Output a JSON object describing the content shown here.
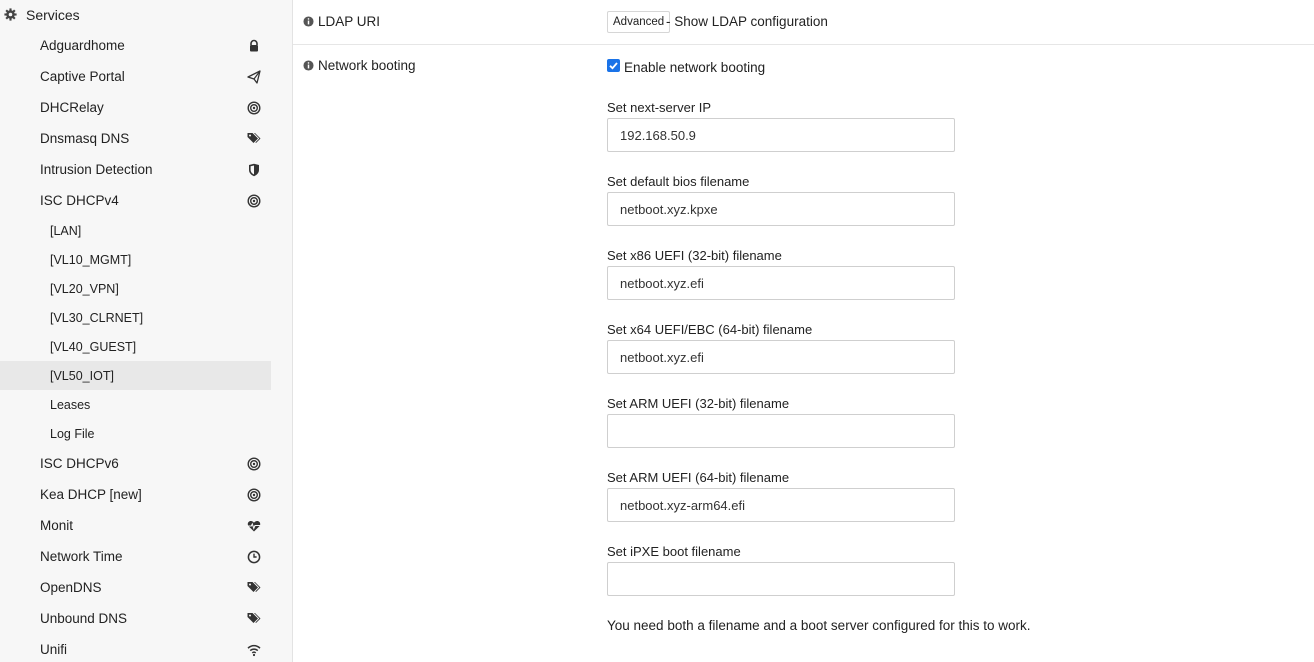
{
  "sidebar": {
    "section": {
      "label": "Services",
      "icon": "gear-icon"
    },
    "items": [
      {
        "label": "Adguardhome",
        "icon": "lock-icon"
      },
      {
        "label": "Captive Portal",
        "icon": "paper-plane-icon"
      },
      {
        "label": "DHCRelay",
        "icon": "bullseye-icon"
      },
      {
        "label": "Dnsmasq DNS",
        "icon": "tags-icon"
      },
      {
        "label": "Intrusion Detection",
        "icon": "shield-icon"
      },
      {
        "label": "ISC DHCPv4",
        "icon": "bullseye-icon"
      }
    ],
    "subitems": [
      {
        "label": "[LAN]"
      },
      {
        "label": "[VL10_MGMT]"
      },
      {
        "label": "[VL20_VPN]"
      },
      {
        "label": "[VL30_CLRNET]"
      },
      {
        "label": "[VL40_GUEST]"
      },
      {
        "label": "[VL50_IOT]",
        "active": true
      },
      {
        "label": "Leases"
      },
      {
        "label": "Log File"
      }
    ],
    "items2": [
      {
        "label": "ISC DHCPv6",
        "icon": "bullseye-icon"
      },
      {
        "label": "Kea DHCP [new]",
        "icon": "bullseye-icon"
      },
      {
        "label": "Monit",
        "icon": "heartbeat-icon"
      },
      {
        "label": "Network Time",
        "icon": "clock-icon"
      },
      {
        "label": "OpenDNS",
        "icon": "tags-icon"
      },
      {
        "label": "Unbound DNS",
        "icon": "tags-icon"
      },
      {
        "label": "Unifi",
        "icon": "wifi-icon"
      }
    ]
  },
  "main": {
    "ldap": {
      "label": "LDAP URI",
      "button": "Advanced",
      "text": "- Show LDAP configuration"
    },
    "netboot": {
      "label": "Network booting",
      "checkbox_label": "Enable network booting",
      "checked": true,
      "fields": [
        {
          "label": "Set next-server IP",
          "value": "192.168.50.9"
        },
        {
          "label": "Set default bios filename",
          "value": "netboot.xyz.kpxe"
        },
        {
          "label": "Set x86 UEFI (32-bit) filename",
          "value": "netboot.xyz.efi"
        },
        {
          "label": "Set x64 UEFI/EBC (64-bit) filename",
          "value": "netboot.xyz.efi"
        },
        {
          "label": "Set ARM UEFI (32-bit) filename",
          "value": ""
        },
        {
          "label": "Set ARM UEFI (64-bit) filename",
          "value": "netboot.xyz-arm64.efi"
        },
        {
          "label": "Set iPXE boot filename",
          "value": ""
        }
      ],
      "note": "You need both a filename and a boot server configured for this to work."
    }
  },
  "colors": {
    "accent": "#1a73e8",
    "icon": "#333333"
  }
}
